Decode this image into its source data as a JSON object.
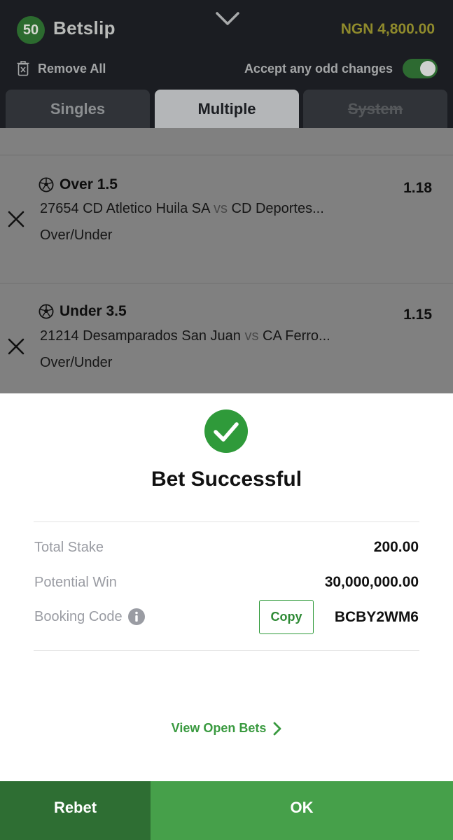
{
  "header": {
    "selection_count": "50",
    "title": "Betslip",
    "balance": "NGN 4,800.00",
    "remove_all_label": "Remove All",
    "accept_odds_label": "Accept any odd changes",
    "accept_odds_enabled": true,
    "icons": {
      "collapse": "chevron-down-icon",
      "trash": "trash-icon"
    }
  },
  "tabs": [
    {
      "label": "Singles",
      "active": false,
      "disabled": false
    },
    {
      "label": "Multiple",
      "active": true,
      "disabled": false
    },
    {
      "label": "System",
      "active": false,
      "disabled": true
    }
  ],
  "bets": [
    {
      "pick": "Over 1.5",
      "odds": "1.18",
      "home": "27654 CD Atletico Huila SA",
      "vs": "vs",
      "away": "CD Deportes...",
      "market": "Over/Under"
    },
    {
      "pick": "Under 3.5",
      "odds": "1.15",
      "home": "21214 Desamparados San Juan",
      "vs": "vs",
      "away": "CA Ferro...",
      "market": "Over/Under"
    }
  ],
  "result": {
    "headline": "Bet Successful",
    "total_stake_label": "Total Stake",
    "total_stake": "200.00",
    "potential_win_label": "Potential Win",
    "potential_win": "30,000,000.00",
    "booking_code_label": "Booking Code",
    "copy_label": "Copy",
    "booking_code": "BCBY2WM6",
    "view_open_bets_label": "View Open Bets"
  },
  "footer": {
    "rebet_label": "Rebet",
    "ok_label": "OK"
  },
  "colors": {
    "brand_green": "#46a04a",
    "dark_green": "#2e6e33",
    "success_check": "#2f9a3a",
    "balance_yellow": "#c8c13a"
  }
}
